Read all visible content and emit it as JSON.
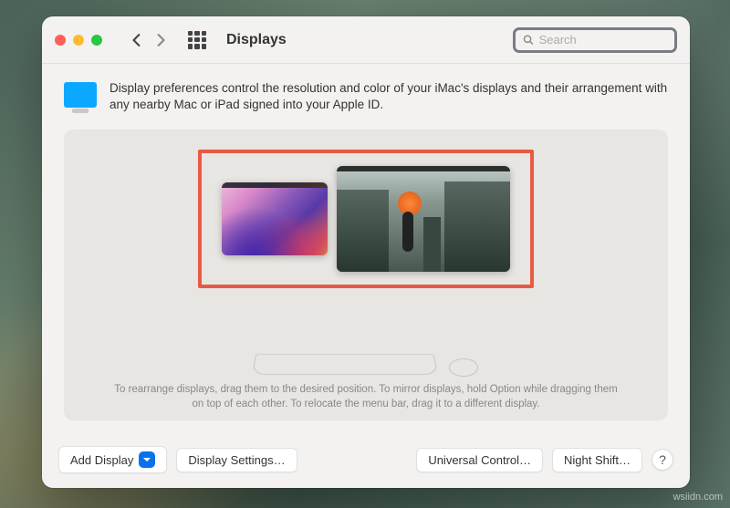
{
  "window": {
    "title": "Displays"
  },
  "search": {
    "placeholder": "Search"
  },
  "intro": {
    "text": "Display preferences control the resolution and color of your iMac's displays and their arrangement with any nearby Mac or iPad signed into your Apple ID."
  },
  "hint": {
    "text": "To rearrange displays, drag them to the desired position. To mirror displays, hold Option while dragging them on top of each other. To relocate the menu bar, drag it to a different display."
  },
  "footer": {
    "add_display": "Add Display",
    "display_settings": "Display Settings…",
    "universal_control": "Universal Control…",
    "night_shift": "Night Shift…",
    "help": "?"
  },
  "watermark": "wsiidn.com"
}
